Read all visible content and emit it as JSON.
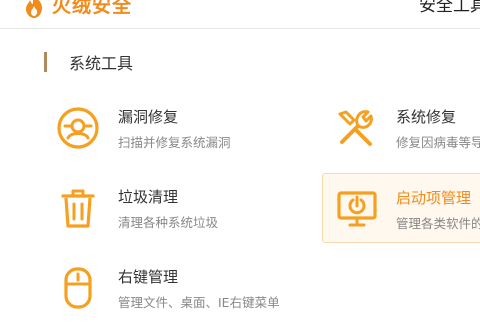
{
  "app": {
    "brand_name": "火绒安全",
    "window_title": "安全工具"
  },
  "section": {
    "title": "系统工具"
  },
  "tools": [
    {
      "name": "漏洞修复",
      "desc": "扫描并修复系统漏洞",
      "icon": "vulnerability-shield-icon"
    },
    {
      "name": "系统修复",
      "desc": "修复因病毒等导",
      "icon": "wrench-screwdriver-icon"
    },
    {
      "name": "垃圾清理",
      "desc": "清理各种系统垃圾",
      "icon": "trash-bin-icon"
    },
    {
      "name": "启动项管理",
      "desc": "管理各类软件的",
      "icon": "monitor-power-icon"
    },
    {
      "name": "右键管理",
      "desc": "管理文件、桌面、IE右键菜单",
      "icon": "mouse-icon"
    }
  ],
  "colors": {
    "accent": "#f5a020",
    "brand": "#f08b1c",
    "highlight_bg": "#fff8ee",
    "highlight_border": "#f6d9b1"
  }
}
